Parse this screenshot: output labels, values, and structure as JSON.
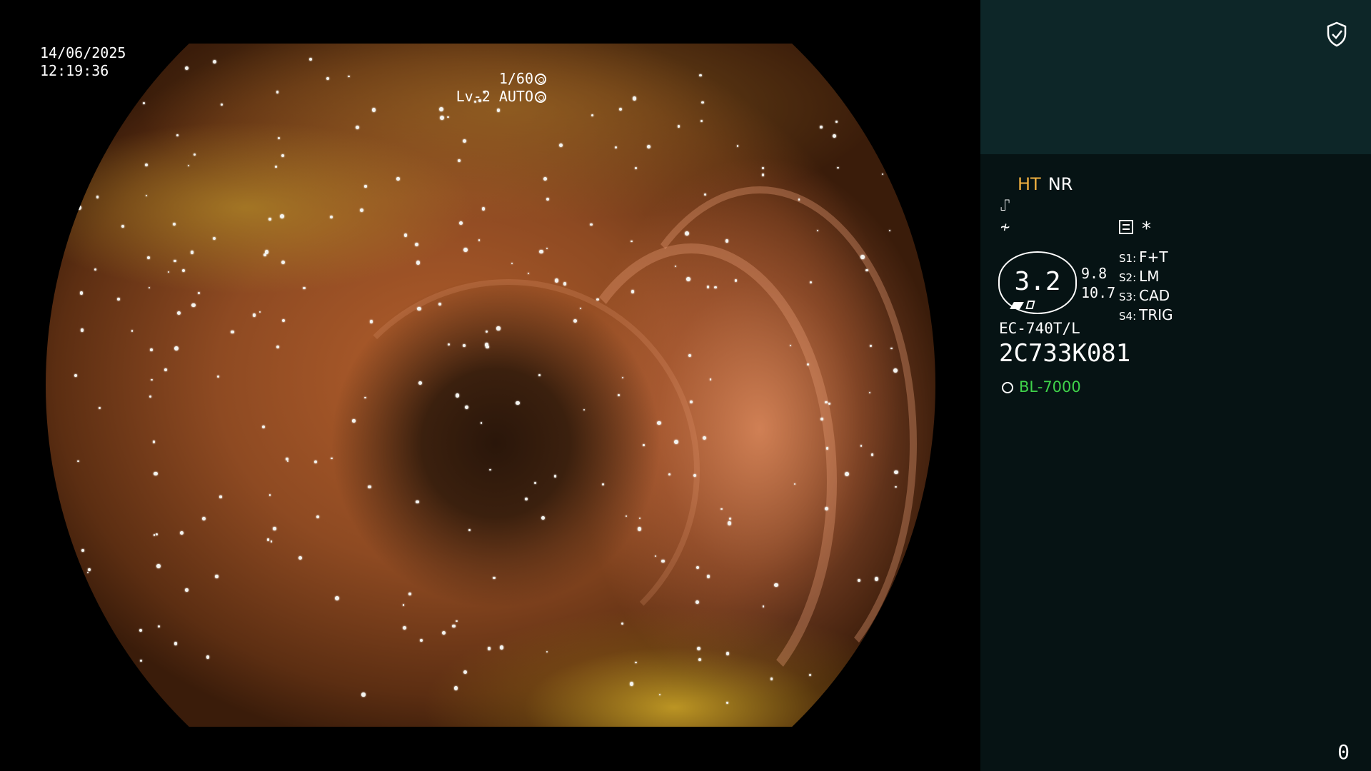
{
  "osd": {
    "date": "14/06/2025",
    "time": "12:19:36",
    "shutter": "1/60",
    "iris": "Lv-2 AUTO"
  },
  "panel": {
    "mode_ht": "HT",
    "mode_nr": "NR",
    "glyph_scope": "⑀",
    "glyph_curve": "≁",
    "asterisk": "*",
    "gauge_value": "3.2",
    "gauge_side_top": "9.8",
    "gauge_side_bottom": "10.7",
    "settings": [
      {
        "key": "S1:",
        "value": "F+T"
      },
      {
        "key": "S2:",
        "value": "LM"
      },
      {
        "key": "S3:",
        "value": "CAD"
      },
      {
        "key": "S4:",
        "value": "TRIG"
      }
    ],
    "model": "EC-740T/L",
    "serial": "2C733K081",
    "light_source": "BL-7000",
    "counter": "0"
  },
  "icons": {
    "shield": "shield-check-icon",
    "shutter": "shutter-icon",
    "iris": "iris-icon",
    "sun": "light-source-icon",
    "settings": "settings-list-icon"
  },
  "colors": {
    "ht_accent": "#f0b040",
    "light_source_green": "#3fd24a",
    "panel_bg": "#061314",
    "panel_top_bg": "#0d2628"
  }
}
